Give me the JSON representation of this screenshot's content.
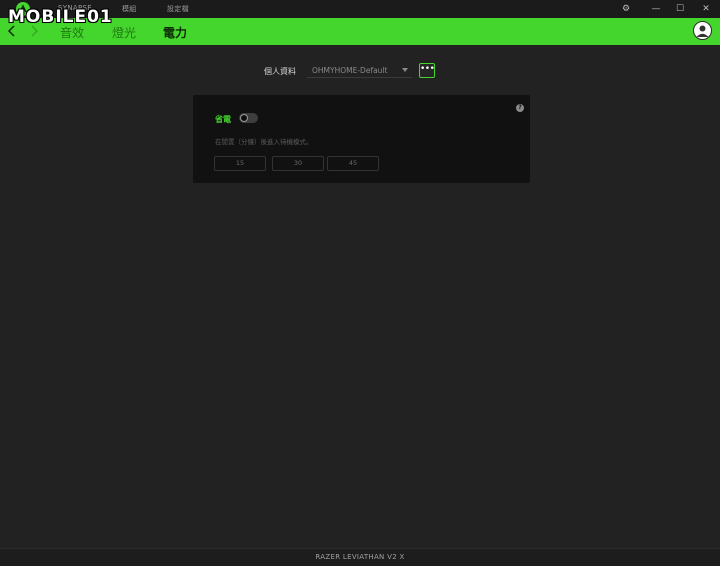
{
  "titlebar": {
    "tabs": [
      "SYNAPSE",
      "模組",
      "設定檔"
    ],
    "buttons": {
      "settings": "⚙",
      "minimize": "—",
      "maximize": "☐",
      "close": "✕"
    }
  },
  "watermark": {
    "text": "MOBILE01"
  },
  "nav": {
    "tabs": [
      {
        "label": "音效",
        "active": false
      },
      {
        "label": "燈光",
        "active": false
      },
      {
        "label": "電力",
        "active": true
      }
    ]
  },
  "profile": {
    "label": "個人資料",
    "selected": "OHMYHOME-Default",
    "more_label": "•••"
  },
  "power_card": {
    "title": "省電",
    "toggle_on": false,
    "description": "在閒置（分鐘）後進入待機模式。",
    "options": [
      "15",
      "30",
      "45"
    ],
    "help": "?"
  },
  "footer": {
    "device": "RAZER LEVIATHAN V2 X"
  },
  "colors": {
    "accent": "#44d62c",
    "background": "#222222",
    "card": "#111111"
  }
}
